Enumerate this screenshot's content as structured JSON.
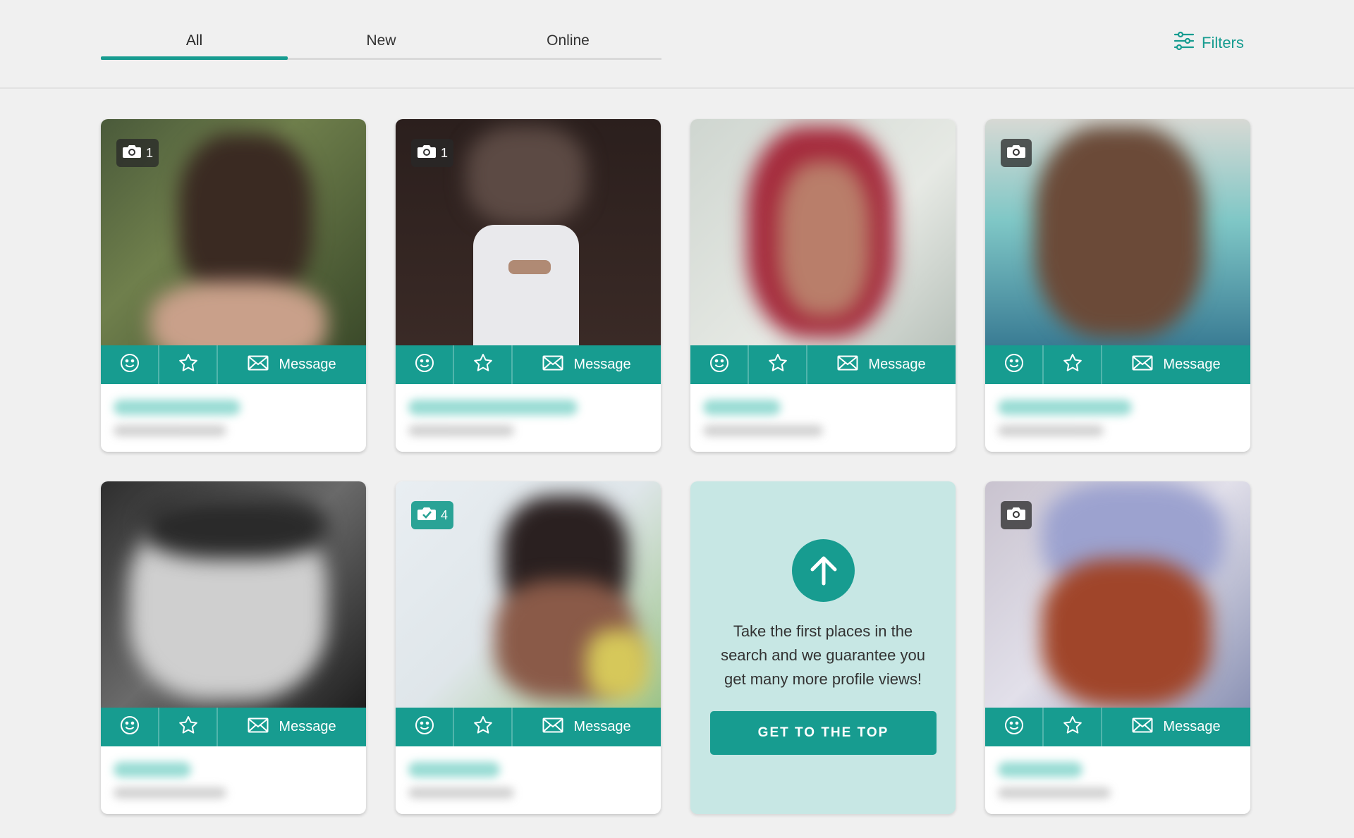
{
  "tabs": [
    {
      "label": "All",
      "active": true
    },
    {
      "label": "New",
      "active": false
    },
    {
      "label": "Online",
      "active": false
    }
  ],
  "filters": {
    "label": "Filters",
    "icon": "sliders-icon"
  },
  "actions": {
    "message_label": "Message",
    "like_icon": "smiley-icon",
    "favorite_icon": "star-icon",
    "message_icon": "envelope-icon"
  },
  "profiles": [
    {
      "photo_count": "1",
      "badge": "camera"
    },
    {
      "photo_count": "1",
      "badge": "camera"
    },
    {
      "photo_count": "",
      "badge": "none"
    },
    {
      "photo_count": "",
      "badge": "camera"
    },
    {
      "photo_count": "",
      "badge": "none"
    },
    {
      "photo_count": "4",
      "badge": "verified"
    },
    {
      "photo_count": "",
      "badge": "camera"
    }
  ],
  "promo": {
    "text": "Take the first places in the search and we guarantee you get many more profile views!",
    "button_label": "GET TO THE TOP",
    "icon": "arrow-up-icon"
  },
  "colors": {
    "accent": "#179c90",
    "promo_bg": "#c7e7e4",
    "page_bg": "#f0f0f0"
  }
}
